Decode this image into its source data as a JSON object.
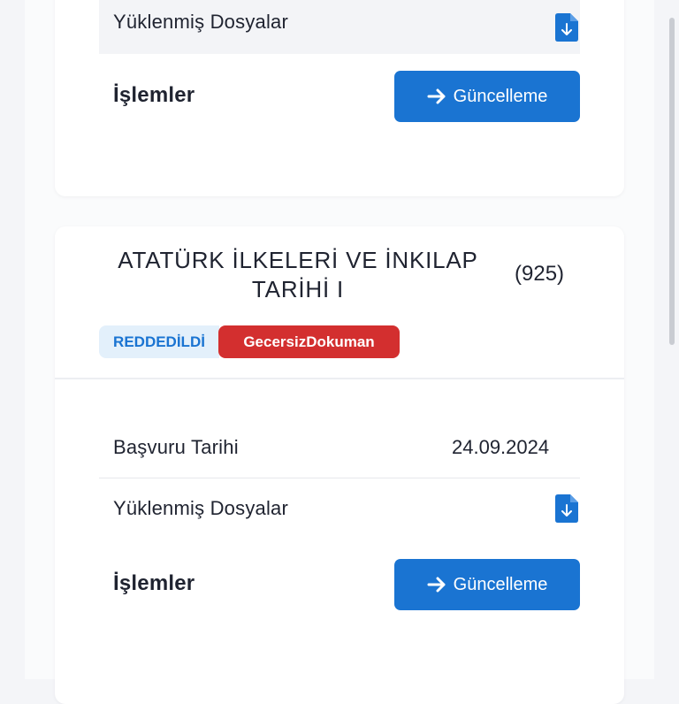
{
  "card_top": {
    "files_label": "Yüklenmiş Dosyalar",
    "actions_label": "İşlemler",
    "update_button": "Güncelleme"
  },
  "card_bottom": {
    "course_title": "ATATÜRK İLKELERİ VE İNKILAP TARİHİ I",
    "course_code": "(925)",
    "status_badge": "REDDEDİLDİ",
    "reason_badge": "GecersizDokuman",
    "application_date_label": "Başvuru Tarihi",
    "application_date_value": "24.09.2024",
    "files_label": "Yüklenmiş Dosyalar",
    "actions_label": "İşlemler",
    "update_button": "Güncelleme"
  },
  "icons": {
    "file_download": "file-download-icon",
    "arrow_right": "arrow-right-icon"
  },
  "colors": {
    "primary": "#1a74d2",
    "danger": "#d32f2f",
    "status_bg": "#e3f0fb"
  }
}
